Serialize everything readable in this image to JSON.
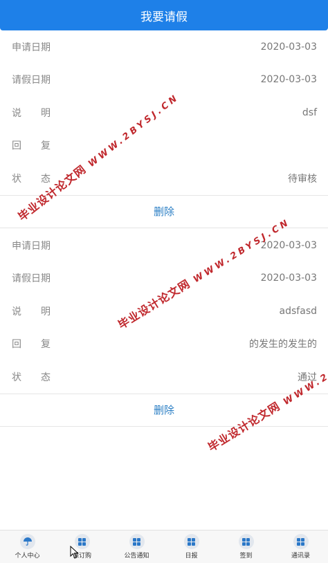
{
  "header": {
    "title": "我要请假"
  },
  "records": [
    {
      "rows": [
        {
          "label": "申请日期",
          "value": "2020-03-03"
        },
        {
          "label": "请假日期",
          "value": "2020-03-03"
        },
        {
          "label": "说明",
          "value": "dsf"
        },
        {
          "label": "回复",
          "value": ""
        },
        {
          "label": "状态",
          "value": "待审核"
        }
      ],
      "delete_label": "删除"
    },
    {
      "rows": [
        {
          "label": "申请日期",
          "value": "2020-03-03"
        },
        {
          "label": "请假日期",
          "value": "2020-03-03"
        },
        {
          "label": "说明",
          "value": "adsfasd"
        },
        {
          "label": "回复",
          "value": "的发生的发生的"
        },
        {
          "label": "状态",
          "value": "通过"
        }
      ],
      "delete_label": "删除"
    }
  ],
  "watermark": {
    "cn": "毕业设计论文网",
    "en": "WWW.2BYSJ.CN"
  },
  "tabbar": {
    "items": [
      {
        "label": "个人中心",
        "icon": "umbrella-icon"
      },
      {
        "label": "课订购",
        "icon": "grid-icon"
      },
      {
        "label": "公告通知",
        "icon": "grid-icon"
      },
      {
        "label": "日报",
        "icon": "grid-icon"
      },
      {
        "label": "签到",
        "icon": "grid-icon"
      },
      {
        "label": "通讯录",
        "icon": "grid-icon"
      }
    ]
  },
  "colors": {
    "header": "#1e80e8",
    "delete": "#2a7ec4",
    "watermark": "#c0282d"
  }
}
